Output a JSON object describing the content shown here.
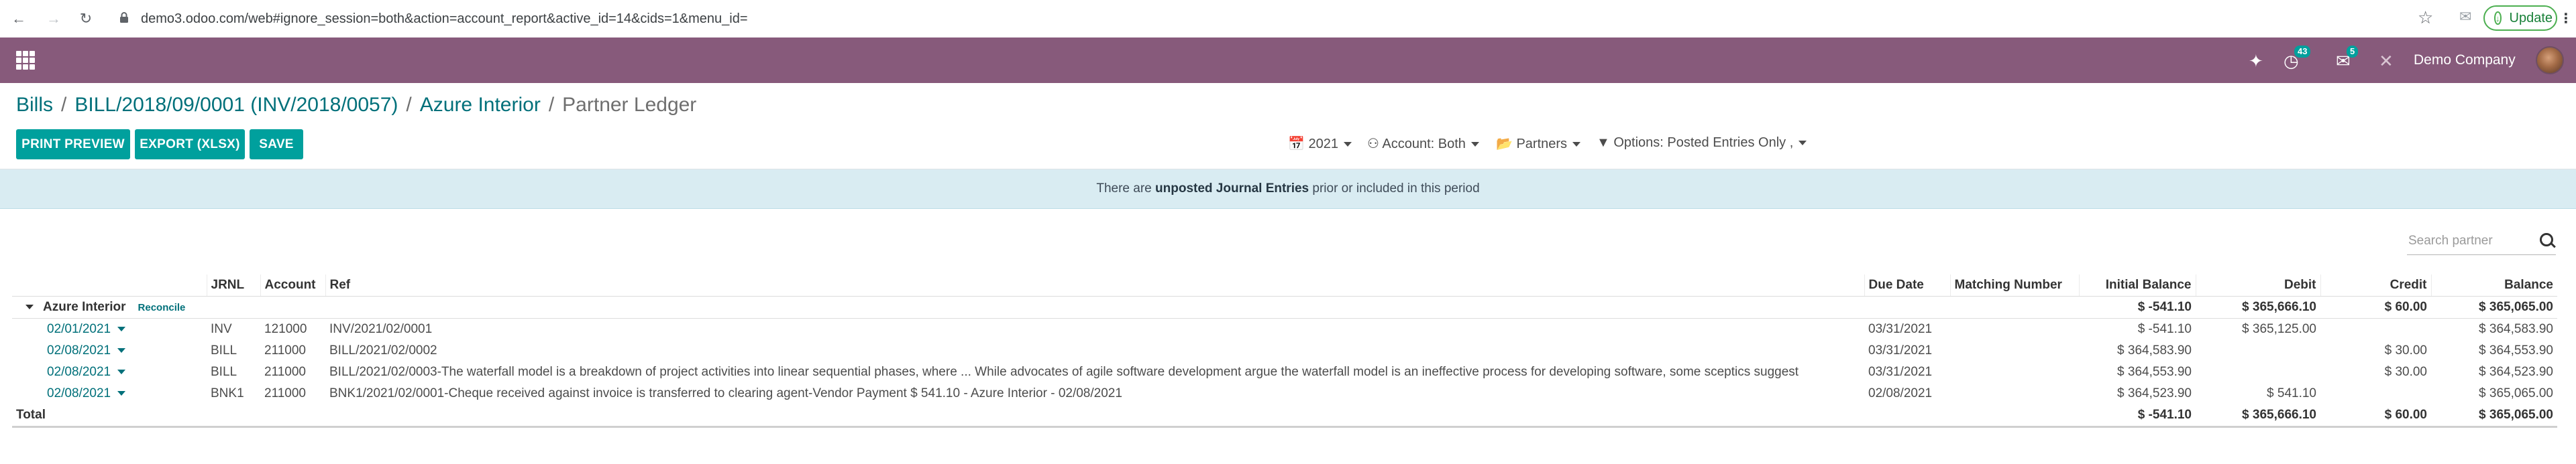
{
  "browser": {
    "url": "demo3.odoo.com/web#ignore_session=both&action=account_report&active_id=14&cids=1&menu_id=",
    "update_label": "Update",
    "update_color": "#188038"
  },
  "navbar": {
    "bg_color": "#875a7b",
    "activity_count": "43",
    "messages_count": "5",
    "company": "Demo Company"
  },
  "breadcrumb": {
    "items": [
      "Bills",
      "BILL/2018/09/0001 (INV/2018/0057)",
      "Azure Interior"
    ],
    "current": "Partner Ledger"
  },
  "buttons": {
    "print_preview": "PRINT PREVIEW",
    "export": "EXPORT (XLSX)",
    "save": "SAVE",
    "accent_color": "#00a09d"
  },
  "filters": {
    "period": "2021",
    "account": "Account: Both",
    "partners": "Partners",
    "options": "Options: Posted Entries Only ,"
  },
  "banner": {
    "pre": "There are ",
    "bold": "unposted Journal Entries",
    "post": " prior or included in this period"
  },
  "search": {
    "placeholder": "Search partner"
  },
  "table": {
    "headers": {
      "jrnl": "JRNL",
      "account": "Account",
      "ref": "Ref",
      "due_date": "Due Date",
      "matching": "Matching Number",
      "initial_balance": "Initial Balance",
      "debit": "Debit",
      "credit": "Credit",
      "balance": "Balance"
    },
    "partner": {
      "name": "Azure Interior",
      "reconcile": "Reconcile",
      "initial_balance": "$ -541.10",
      "debit": "$ 365,666.10",
      "credit": "$ 60.00",
      "balance": "$ 365,065.00"
    },
    "rows": [
      {
        "date": "02/01/2021",
        "jrnl": "INV",
        "account": "121000",
        "ref": "INV/2021/02/0001",
        "due_date": "03/31/2021",
        "matching": "",
        "initial_balance": "$ -541.10",
        "debit": "$ 365,125.00",
        "credit": "",
        "balance": "$ 364,583.90"
      },
      {
        "date": "02/08/2021",
        "jrnl": "BILL",
        "account": "211000",
        "ref": "BILL/2021/02/0002",
        "due_date": "03/31/2021",
        "matching": "",
        "initial_balance": "$ 364,583.90",
        "debit": "",
        "credit": "$ 30.00",
        "balance": "$ 364,553.90"
      },
      {
        "date": "02/08/2021",
        "jrnl": "BILL",
        "account": "211000",
        "ref": "BILL/2021/02/0003-The waterfall model is a breakdown of project activities into linear sequential phases, where ... While advocates of agile software development argue the waterfall model is an ineffective process for developing software, some sceptics suggest",
        "due_date": "03/31/2021",
        "matching": "",
        "initial_balance": "$ 364,553.90",
        "debit": "",
        "credit": "$ 30.00",
        "balance": "$ 364,523.90"
      },
      {
        "date": "02/08/2021",
        "jrnl": "BNK1",
        "account": "211000",
        "ref": "BNK1/2021/02/0001-Cheque received against invoice is transferred to clearing agent-Vendor Payment $ 541.10 - Azure Interior - 02/08/2021",
        "due_date": "02/08/2021",
        "matching": "",
        "initial_balance": "$ 364,523.90",
        "debit": "$ 541.10",
        "credit": "",
        "balance": "$ 365,065.00"
      }
    ],
    "total": {
      "label": "Total",
      "initial_balance": "$ -541.10",
      "debit": "$ 365,666.10",
      "credit": "$ 60.00",
      "balance": "$ 365,065.00"
    }
  }
}
